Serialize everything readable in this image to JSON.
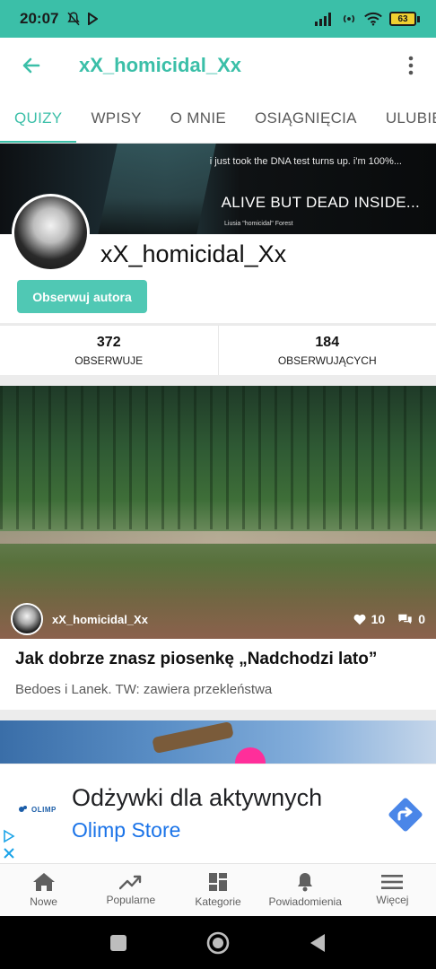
{
  "status_bar": {
    "time": "20:07",
    "battery": "63",
    "icons": [
      "mute-icon",
      "play-icon",
      "signal-icon",
      "hotspot-icon",
      "wifi-icon",
      "battery-icon"
    ]
  },
  "app_bar": {
    "title": "xX_homicidal_Xx",
    "back_icon": "arrow-left-icon",
    "menu_icon": "more-vertical-icon"
  },
  "tabs": [
    {
      "label": "QUIZY",
      "active": true
    },
    {
      "label": "WPISY",
      "active": false
    },
    {
      "label": "O MNIE",
      "active": false
    },
    {
      "label": "OSIĄGNIĘCIA",
      "active": false
    },
    {
      "label": "ULUBIEN",
      "active": false
    }
  ],
  "profile": {
    "banner_line1": "i just took the DNA test turns up. i'm 100%...",
    "banner_line2": "ALIVE BUT DEAD INSIDE...",
    "banner_line3": "Liusia \"homicidal\" Forest",
    "username": "xX_homicidal_Xx",
    "follow_label": "Obserwuj autora",
    "colors": {
      "accent": "#3bbfa8",
      "button": "#50c8b4"
    }
  },
  "stats": [
    {
      "value": "372",
      "label": "OBSERWUJE"
    },
    {
      "value": "184",
      "label": "OBSERWUJĄCYCH"
    }
  ],
  "quiz_card": {
    "author": "xX_homicidal_Xx",
    "likes": "10",
    "comments": "0",
    "title": "Jak dobrze znasz piosenkę „Nadchodzi lato”",
    "description": "Bedoes i Lanek. TW: zawiera przekleństwa"
  },
  "ad": {
    "logo_text": "OLIMP",
    "headline": "Odżywki dla aktywnych",
    "advertiser": "Olimp Store",
    "action_icon": "directions-arrow-icon"
  },
  "bottom_nav": [
    {
      "label": "Nowe",
      "icon": "home-icon"
    },
    {
      "label": "Popularne",
      "icon": "trending-icon"
    },
    {
      "label": "Kategorie",
      "icon": "grid-icon"
    },
    {
      "label": "Powiadomienia",
      "icon": "bell-icon"
    },
    {
      "label": "Więcej",
      "icon": "menu-icon"
    }
  ]
}
